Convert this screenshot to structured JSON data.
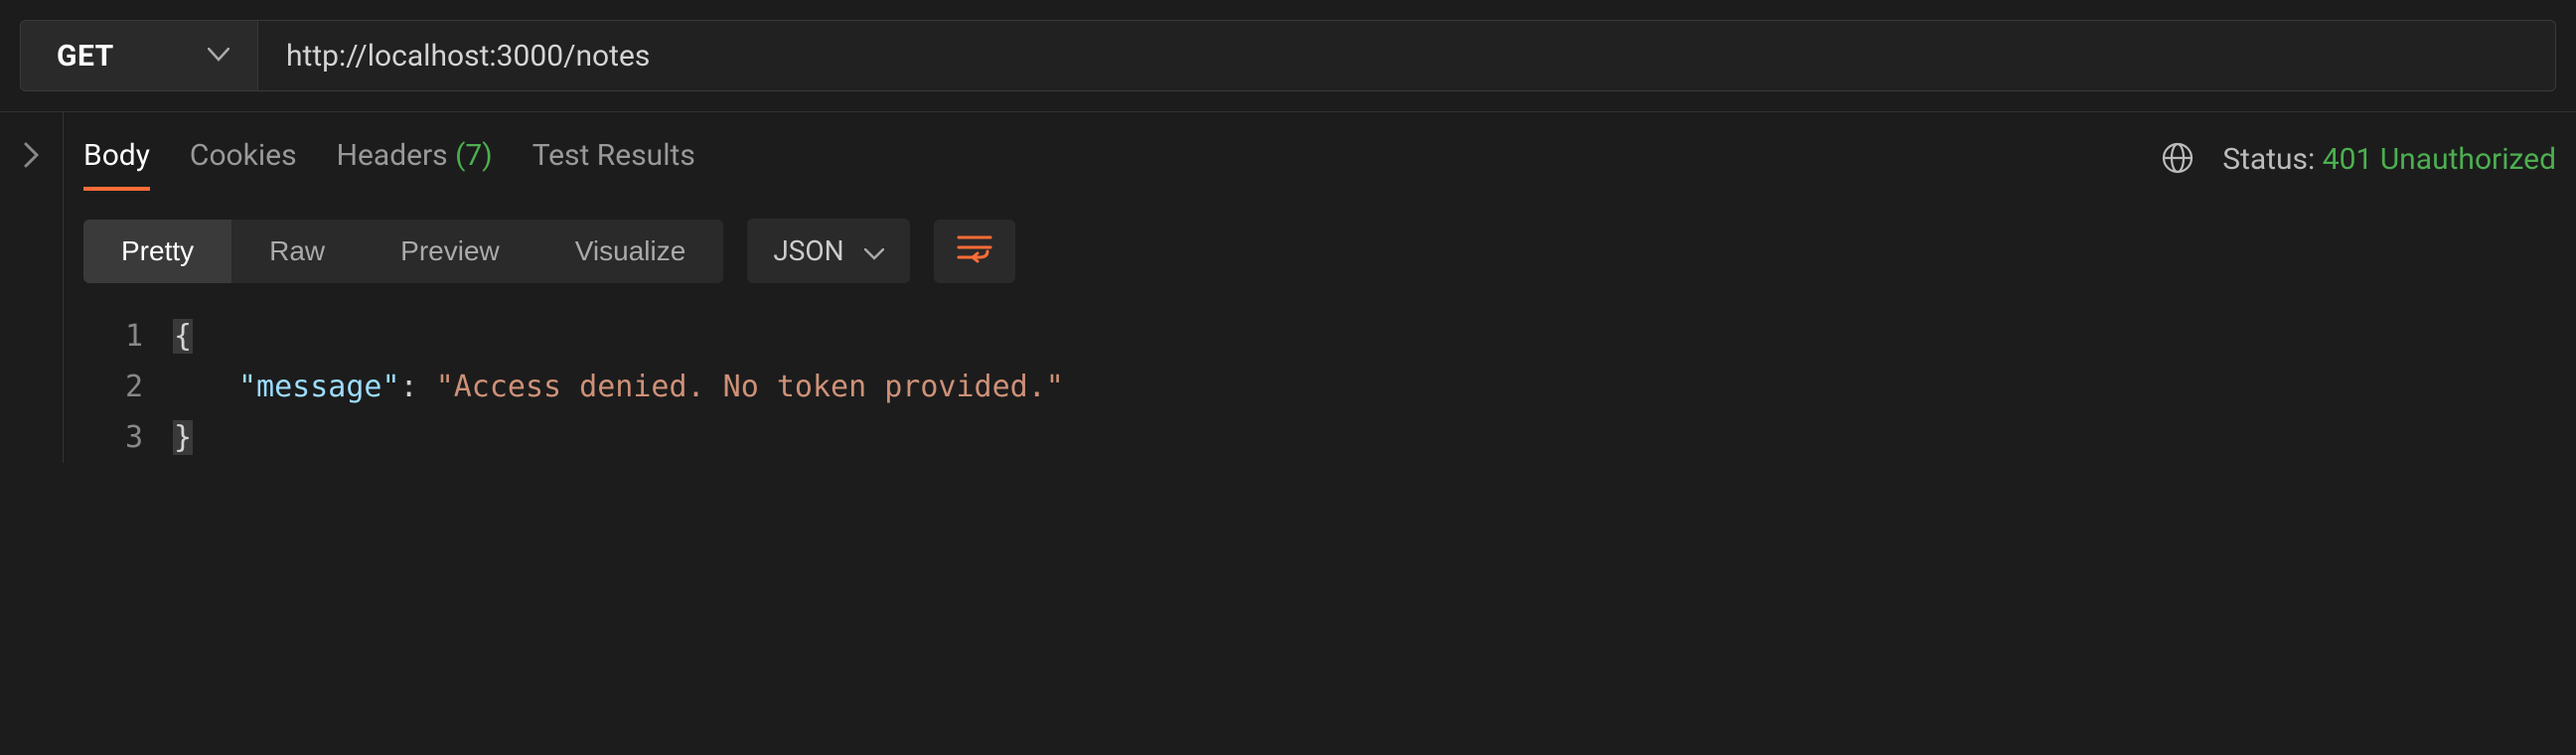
{
  "request": {
    "method": "GET",
    "url": "http://localhost:3000/notes"
  },
  "response_tabs": {
    "body": "Body",
    "cookies": "Cookies",
    "headers_label": "Headers",
    "headers_count": "(7)",
    "test_results": "Test Results"
  },
  "status": {
    "label": "Status:",
    "value": "401 Unauthorized"
  },
  "view_modes": {
    "pretty": "Pretty",
    "raw": "Raw",
    "preview": "Preview",
    "visualize": "Visualize"
  },
  "format": {
    "selected": "JSON"
  },
  "code": {
    "lines": [
      "1",
      "2",
      "3"
    ],
    "brace_open": "{",
    "brace_close": "}",
    "key_quoted": "\"message\"",
    "colon": ":",
    "value_quoted": "\"Access denied. No token provided.\""
  }
}
